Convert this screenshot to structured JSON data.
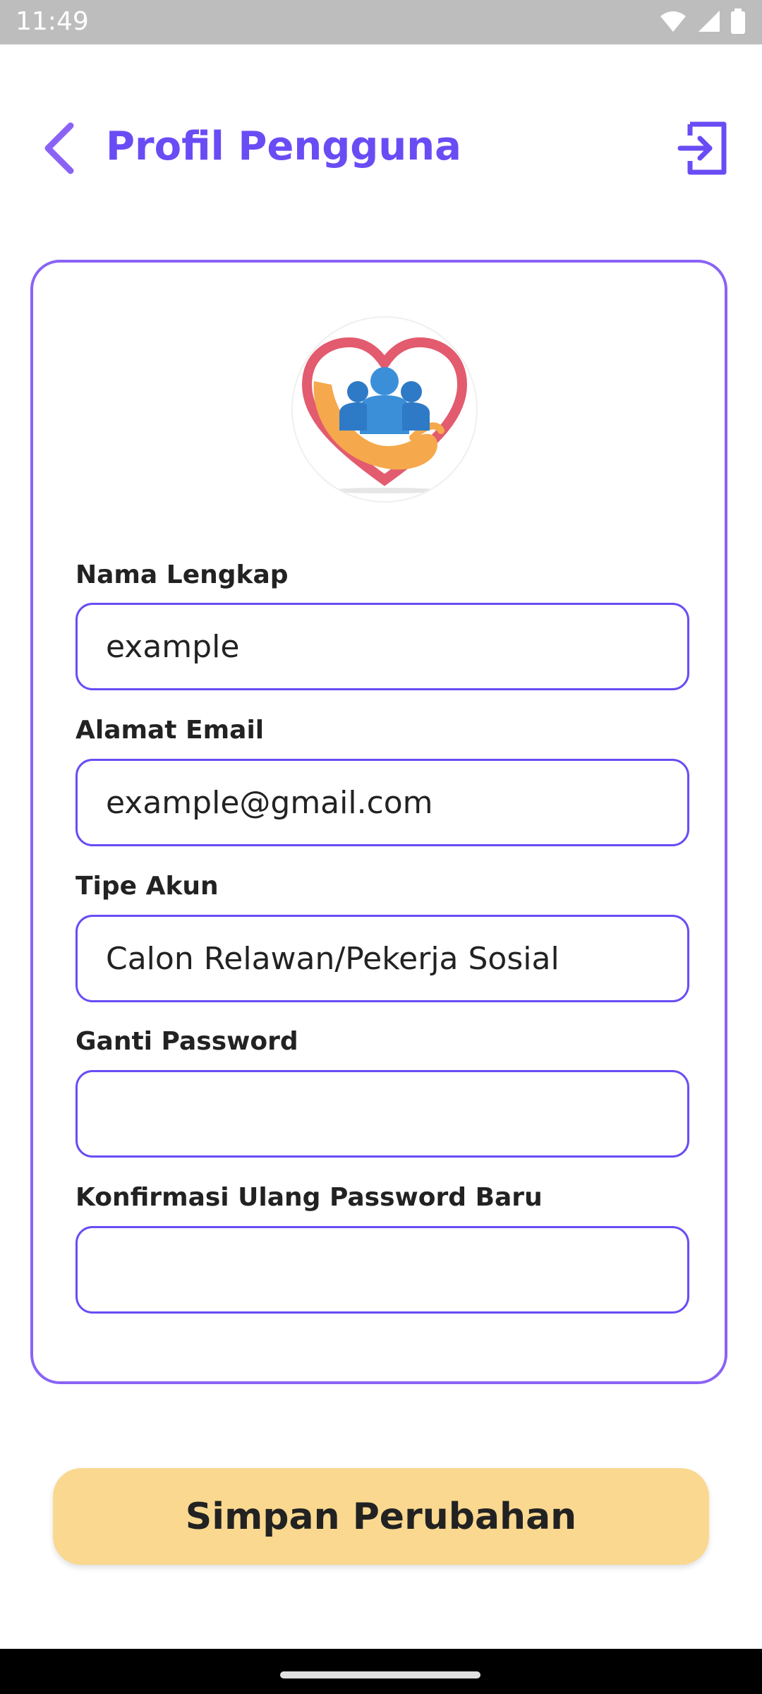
{
  "status_bar": {
    "time": "11:49"
  },
  "header": {
    "title": "Profil Pengguna"
  },
  "form": {
    "full_name": {
      "label": "Nama Lengkap",
      "value": "example"
    },
    "email": {
      "label": "Alamat Email",
      "value": "example@gmail.com"
    },
    "account_type": {
      "label": "Tipe Akun",
      "value": "Calon Relawan/Pekerja Sosial"
    },
    "change_password": {
      "label": "Ganti Password",
      "value": ""
    },
    "confirm_password": {
      "label": "Konfirmasi Ulang Password Baru",
      "value": ""
    }
  },
  "actions": {
    "save_label": "Simpan Perubahan"
  },
  "colors": {
    "accent": "#6a4cf5",
    "card_border": "#8a63f5",
    "save_button": "#fad890"
  }
}
